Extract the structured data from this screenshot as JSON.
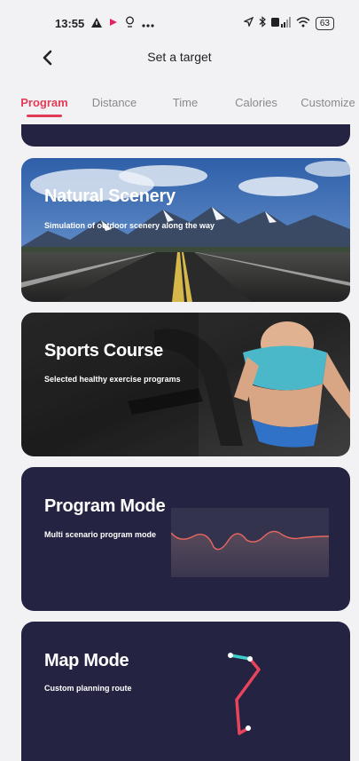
{
  "status": {
    "time": "13:55",
    "battery": "63",
    "left_icons": [
      "warning-icon",
      "flag-icon",
      "location-pin-icon",
      "more-icon"
    ],
    "right_icons": [
      "nav-arrow-icon",
      "bluetooth-icon",
      "signal-icon",
      "wifi-icon"
    ]
  },
  "header": {
    "title": "Set a target"
  },
  "tabs": [
    {
      "label": "Program",
      "active": true
    },
    {
      "label": "Distance",
      "active": false
    },
    {
      "label": "Time",
      "active": false
    },
    {
      "label": "Calories",
      "active": false
    },
    {
      "label": "Customize",
      "active": false
    }
  ],
  "cards": {
    "scenery": {
      "title": "Natural Scenery",
      "subtitle": "Simulation of outdoor scenery along the way"
    },
    "course": {
      "title": "Sports Course",
      "subtitle": "Selected healthy exercise programs"
    },
    "program": {
      "title": "Program Mode",
      "subtitle": "Multi scenario program mode"
    },
    "map": {
      "title": "Map Mode",
      "subtitle": "Custom planning route"
    }
  },
  "colors": {
    "accent": "#e23b55",
    "card_dark": "#242341",
    "route_start": "#3fd0c9",
    "route_end": "#e8455d"
  }
}
